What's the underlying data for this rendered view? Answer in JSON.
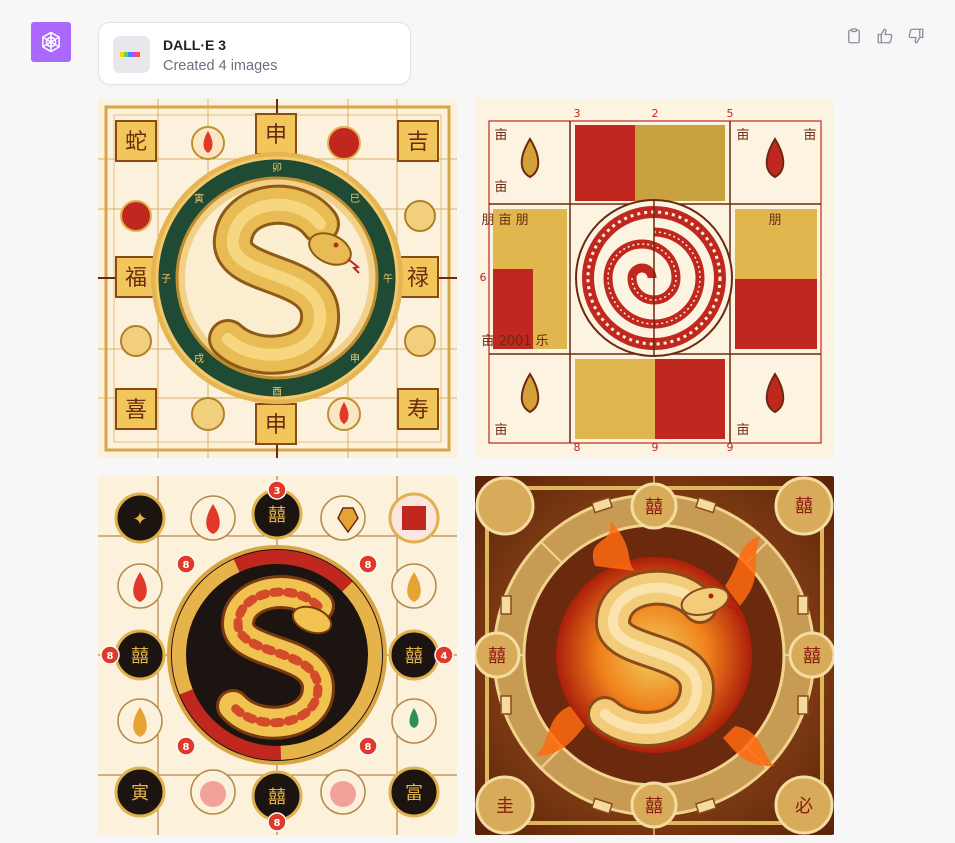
{
  "message": {
    "avatar_icon": "openai-logo-icon",
    "avatar_color": "#ab68ff"
  },
  "tool": {
    "name": "DALL·E 3",
    "status": "Created 4 images",
    "thumb_colors": [
      "#ffd400",
      "#5ad15a",
      "#3a8bff",
      "#b34bff",
      "#ff4d4d"
    ]
  },
  "actions": [
    {
      "icon": "clipboard-icon"
    },
    {
      "icon": "thumbs-up-icon"
    },
    {
      "icon": "thumbs-down-icon"
    }
  ],
  "images": [
    {
      "theme": "gold-cream",
      "labels": {
        "top": "",
        "bottom": ""
      }
    },
    {
      "theme": "red-gold-grid",
      "labels": {
        "top": "2",
        "t3": "3",
        "t5": "5",
        "b8": "8",
        "b9": "9",
        "b9b": "9",
        "l6": "6"
      }
    },
    {
      "theme": "red-black-circles",
      "labels": {
        "n3": "3",
        "n8": "8",
        "n4": "4"
      }
    },
    {
      "theme": "fire-bronze",
      "labels": {}
    }
  ],
  "colors": {
    "gold": "#e2b451",
    "red": "#c0281f",
    "cream": "#fbf1dc",
    "green": "#1f4a33",
    "bronze": "#8b4a1c"
  }
}
